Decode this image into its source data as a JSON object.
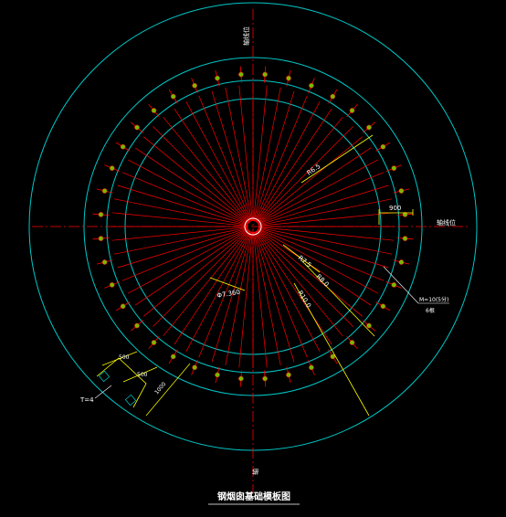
{
  "drawing": {
    "title": "钢烟囱基础模板图",
    "ring_count": 40,
    "colors": {
      "background": "#000000",
      "outline": "#00c8c8",
      "radial": "#ff0000",
      "bolt_fill": "#7ab800",
      "bolt_outline": "#ff0000",
      "dimension": "#ffff00",
      "text": "#ffffff"
    }
  },
  "labels": {
    "axis_top": "轴线位",
    "axis_right": "轴线位",
    "axis_bottom": "轴",
    "dim_right_radius": "R6.5",
    "dim_900": "900",
    "dim_r75": "R7.5",
    "dim_r80": "R8.0",
    "dim_r10": "R10.0",
    "callout_anchor": "M=10(5分)",
    "callout_anchor_sub": "6根",
    "dim_dia": "Φ7.360",
    "dim_500_a": "500",
    "dim_500_b": "500",
    "dim_1000": "1000",
    "tag_t": "T=4"
  }
}
